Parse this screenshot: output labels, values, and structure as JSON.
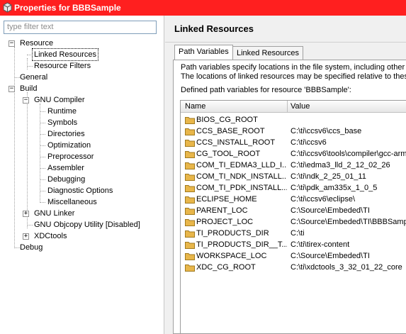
{
  "window": {
    "title": "Properties for BBBSample",
    "icon": "gear-icon"
  },
  "filter": {
    "placeholder": "type filter text"
  },
  "tree": {
    "resource": "Resource",
    "linked_resources": "Linked Resources",
    "resource_filters": "Resource Filters",
    "general": "General",
    "build": "Build",
    "gnu_compiler": "GNU Compiler",
    "compiler_children": [
      "Runtime",
      "Symbols",
      "Directories",
      "Optimization",
      "Preprocessor",
      "Assembler",
      "Debugging",
      "Diagnostic Options",
      "Miscellaneous"
    ],
    "gnu_linker": "GNU Linker",
    "objcopy": "GNU Objcopy Utility  [Disabled]",
    "xdctools": "XDCtools",
    "debug": "Debug"
  },
  "page": {
    "title": "Linked Resources",
    "tabs": [
      "Path Variables",
      "Linked Resources"
    ],
    "desc_line1": "Path variables specify locations in the file system, including other p",
    "desc_line2": "The locations of linked resources may be specified relative to these",
    "defined_label": "Defined path variables for resource 'BBBSample':"
  },
  "table": {
    "headers": {
      "name": "Name",
      "value": "Value"
    },
    "rows": [
      {
        "name": "BIOS_CG_ROOT",
        "value": ""
      },
      {
        "name": "CCS_BASE_ROOT",
        "value": "C:\\ti\\ccsv6\\ccs_base"
      },
      {
        "name": "CCS_INSTALL_ROOT",
        "value": "C:\\ti\\ccsv6"
      },
      {
        "name": "CG_TOOL_ROOT",
        "value": "C:\\ti\\ccsv6\\tools\\compiler\\gcc-arm"
      },
      {
        "name": "COM_TI_EDMA3_LLD_I...",
        "value": "C:\\ti\\edma3_lld_2_12_02_26"
      },
      {
        "name": "COM_TI_NDK_INSTALL...",
        "value": "C:\\ti\\ndk_2_25_01_11"
      },
      {
        "name": "COM_TI_PDK_INSTALL...",
        "value": "C:\\ti\\pdk_am335x_1_0_5"
      },
      {
        "name": "ECLIPSE_HOME",
        "value": "C:\\ti\\ccsv6\\eclipse\\"
      },
      {
        "name": "PARENT_LOC",
        "value": "C:\\Source\\Embeded\\TI"
      },
      {
        "name": "PROJECT_LOC",
        "value": "C:\\Source\\Embeded\\TI\\BBBSample"
      },
      {
        "name": "TI_PRODUCTS_DIR",
        "value": "C:\\ti"
      },
      {
        "name": "TI_PRODUCTS_DIR__T...",
        "value": "C:\\ti\\tirex-content"
      },
      {
        "name": "WORKSPACE_LOC",
        "value": "C:\\Source\\Embeded\\TI"
      },
      {
        "name": "XDC_CG_ROOT",
        "value": "C:\\ti\\xdctools_3_32_01_22_core"
      }
    ]
  },
  "colors": {
    "titlebar": "#ff1f1f",
    "folder": "#e8b64a",
    "selection_outline": "#000000"
  }
}
